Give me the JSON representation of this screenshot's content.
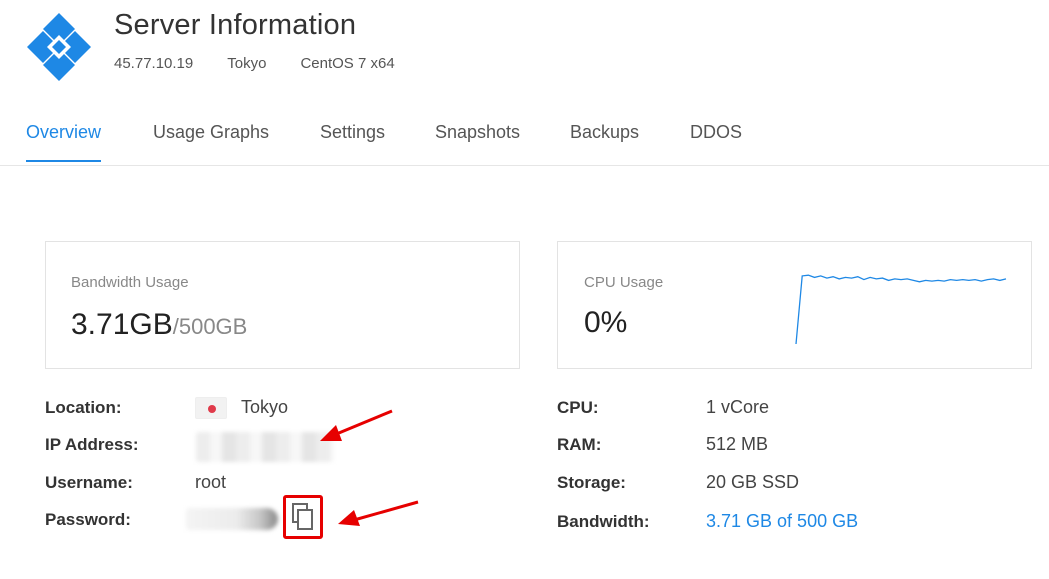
{
  "header": {
    "title": "Server Information",
    "ip": "45.77.10.19",
    "location": "Tokyo",
    "os": "CentOS 7 x64"
  },
  "tabs": [
    {
      "label": "Overview",
      "active": true
    },
    {
      "label": "Usage Graphs",
      "active": false
    },
    {
      "label": "Settings",
      "active": false
    },
    {
      "label": "Snapshots",
      "active": false
    },
    {
      "label": "Backups",
      "active": false
    },
    {
      "label": "DDOS",
      "active": false
    }
  ],
  "bandwidth_card": {
    "label": "Bandwidth Usage",
    "used": "3.71GB",
    "total": "/500GB"
  },
  "cpu_card": {
    "label": "CPU Usage",
    "value": "0%",
    "sparkline": [
      0,
      92,
      93,
      90,
      92,
      89,
      91,
      88,
      90,
      89,
      91,
      87,
      90,
      88,
      89,
      86,
      88,
      87,
      88,
      86,
      84,
      86,
      85,
      86,
      85,
      87,
      86,
      87,
      86,
      87,
      85,
      87,
      88,
      86,
      88
    ]
  },
  "details_left": [
    {
      "label": "Location:",
      "value": "Tokyo",
      "icon": "japan-flag-icon"
    },
    {
      "label": "IP Address:",
      "value": ""
    },
    {
      "label": "Username:",
      "value": "root"
    },
    {
      "label": "Password:",
      "value": ""
    }
  ],
  "details_right": [
    {
      "label": "CPU:",
      "value": "1 vCore"
    },
    {
      "label": "RAM:",
      "value": "512 MB"
    },
    {
      "label": "Storage:",
      "value": "20 GB SSD"
    },
    {
      "label": "Bandwidth:",
      "value": "3.71 GB of 500 GB"
    }
  ],
  "colors": {
    "accent": "#1e88e5",
    "annotation": "#e60000",
    "logo": "#1e88e5"
  }
}
